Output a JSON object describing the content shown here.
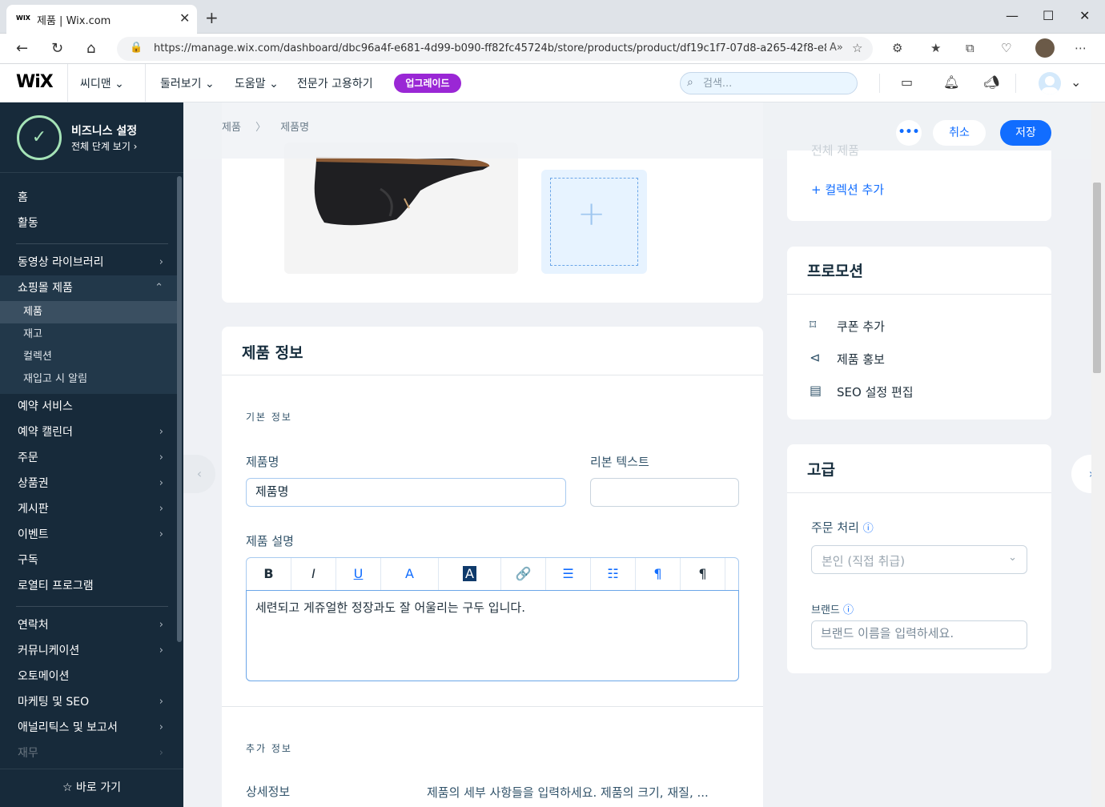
{
  "browser": {
    "tab_favicon": "WIX",
    "tab_title": "제품 | Wix.com",
    "tab_close": "✕",
    "new_tab": "+",
    "url": "https://manage.wix.com/dashboard/dbc96a4f-e681-4d99-b090-ff82fc45724b/store/products/product/df19c1f7-07d8-a265-42f8-e8...",
    "window_minimize": "—",
    "window_maximize": "☐",
    "window_close": "✕"
  },
  "wix_header": {
    "logo": "WiX",
    "site_name": "씨디맨",
    "menu_browse": "둘러보기",
    "menu_help": "도움말",
    "menu_hire": "전문가 고용하기",
    "upgrade": "업그레이드",
    "search_placeholder": "검색..."
  },
  "sidebar": {
    "business_title": "비즈니스 설정",
    "business_sub": "전체 단계 보기 ›",
    "items_top": [
      "홈",
      "활동"
    ],
    "items_mid": [
      {
        "label": "동영상 라이브러리",
        "chevron": "›"
      },
      {
        "label": "쇼핑몰 제품",
        "chevron": "⌃"
      }
    ],
    "sub_items": [
      "제품",
      "재고",
      "컬렉션",
      "재입고 시 알림"
    ],
    "items_main": [
      {
        "label": "예약 서비스",
        "chevron": ""
      },
      {
        "label": "예약 캘린더",
        "chevron": "›"
      },
      {
        "label": "주문",
        "chevron": "›"
      },
      {
        "label": "상품권",
        "chevron": "›"
      },
      {
        "label": "게시판",
        "chevron": "›"
      },
      {
        "label": "이벤트",
        "chevron": "›"
      },
      {
        "label": "구독",
        "chevron": ""
      },
      {
        "label": "로열티 프로그램",
        "chevron": ""
      }
    ],
    "items_bottom": [
      {
        "label": "연락처",
        "chevron": "›"
      },
      {
        "label": "커뮤니케이션",
        "chevron": "›"
      },
      {
        "label": "오토메이션",
        "chevron": ""
      },
      {
        "label": "마케팅 및 SEO",
        "chevron": "›"
      },
      {
        "label": "애널리틱스 및 보고서",
        "chevron": "›"
      },
      {
        "label": "재무",
        "chevron": "›"
      }
    ],
    "quick_access": "☆ 바로 가기"
  },
  "page": {
    "breadcrumb_root": "제품",
    "breadcrumb_sep": "〉",
    "breadcrumb_current": "제품명",
    "more": "•••",
    "cancel": "취소",
    "save": "저장"
  },
  "product_info": {
    "title": "제품 정보",
    "basic_section": "기본 정보",
    "name_label": "제품명",
    "name_value": "제품명",
    "ribbon_label": "리본 텍스트",
    "ribbon_value": "",
    "desc_label": "제품 설명",
    "toolbar": [
      "B",
      "I",
      "U",
      "A",
      "A",
      "🔗",
      "☰",
      "☷",
      "¶",
      "¶"
    ],
    "description": "세련되고 게쥬얼한 정장과도 잘 어울리는 구두 입니다.",
    "additional_section": "추가 정보",
    "detail_label": "상세정보",
    "detail_placeholder": "제품의 세부 사항들을 입력하세요. 제품의 크기, 재질, ..."
  },
  "collections": {
    "partial_item": "전체 제품",
    "add_collection": "+ 컬렉션 추가"
  },
  "promotion": {
    "title": "프로모션",
    "add_coupon": "쿠폰 추가",
    "promote": "제품 홍보",
    "seo_edit": "SEO 설정 편집"
  },
  "advanced": {
    "title": "고급",
    "fulfillment_label": "주문 처리",
    "fulfillment_value": "본인 (직접 취급)",
    "brand_label": "브랜드",
    "brand_placeholder": "브랜드 이름을 입력하세요."
  }
}
